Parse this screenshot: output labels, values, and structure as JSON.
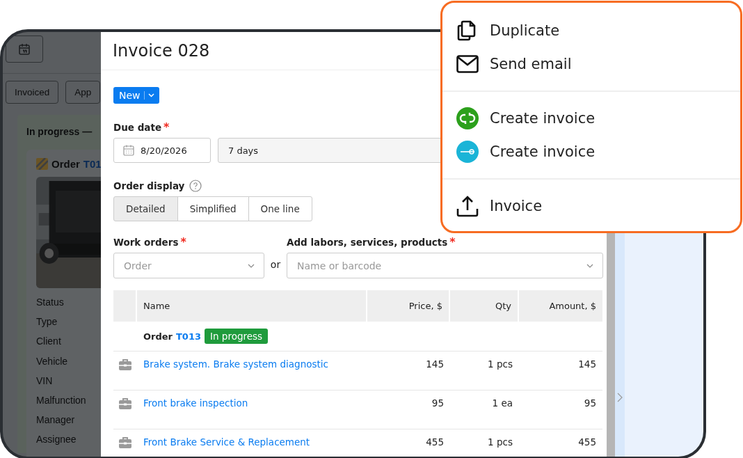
{
  "background_app": {
    "tabs": [
      {
        "label": "Invoiced"
      },
      {
        "label": "App"
      }
    ],
    "column_title": "In progress —",
    "card": {
      "title": "Order",
      "number": "T01",
      "fields": [
        "Status",
        "Type",
        "Client",
        "Vehicle",
        "VIN",
        "Malfunction",
        "Manager",
        "Assignee"
      ]
    }
  },
  "modal": {
    "title": "Invoice 028",
    "new_button": "New",
    "due_date": {
      "label": "Due date",
      "mark": "*",
      "date": "8/20/2026",
      "term": "7 days"
    },
    "order_display": {
      "label": "Order display",
      "options": [
        {
          "label": "Detailed",
          "selected": true
        },
        {
          "label": "Simplified",
          "selected": false
        },
        {
          "label": "One line",
          "selected": false
        }
      ]
    },
    "work_orders": {
      "label": "Work orders",
      "mark": "*",
      "placeholder": "Order"
    },
    "separator": "or",
    "items_field": {
      "label": "Add labors, services, products",
      "mark": "*",
      "placeholder": "Name or barcode"
    },
    "table": {
      "columns": [
        "Name",
        "Price, $",
        "Qty",
        "Amount, $"
      ],
      "order": {
        "label": "Order",
        "number": "T013",
        "status": "In progress"
      },
      "rows": [
        {
          "name": "Brake system. Brake system diagnostic",
          "price": "145",
          "qty": "1 pcs",
          "amount": "145"
        },
        {
          "name": "Front brake inspection",
          "price": "95",
          "qty": "1 ea",
          "amount": "95"
        },
        {
          "name": "Front Brake Service & Replacement",
          "price": "455",
          "qty": "1 pcs",
          "amount": "455"
        }
      ]
    }
  },
  "menu": {
    "groups": [
      [
        {
          "label": "Duplicate",
          "kind": "copy"
        },
        {
          "label": "Send email",
          "kind": "email"
        }
      ],
      [
        {
          "label": "Create invoice",
          "kind": "qb"
        },
        {
          "label": "Create invoice",
          "kind": "xero"
        }
      ],
      [
        {
          "label": "Invoice",
          "kind": "upload"
        }
      ]
    ]
  }
}
